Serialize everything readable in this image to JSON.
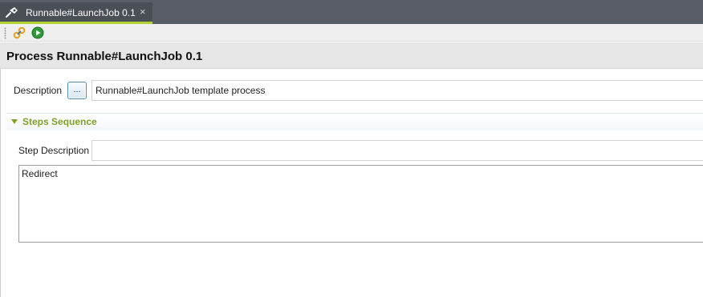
{
  "tab": {
    "title": "Runnable#LaunchJob 0.1",
    "close_glyph": "×"
  },
  "toolbar": {
    "buttons": [
      {
        "name": "refresh-links-icon",
        "color": "#e0a21a"
      },
      {
        "name": "run-icon",
        "color": "#2f9a3a"
      }
    ]
  },
  "header": {
    "title": "Process Runnable#LaunchJob 0.1"
  },
  "description": {
    "label": "Description",
    "button_label": "...",
    "value": "Runnable#LaunchJob template process"
  },
  "steps_section": {
    "title": "Steps Sequence",
    "step_description_label": "Step Description",
    "step_description_value": "",
    "steps_text": "Redirect"
  },
  "colors": {
    "tab_bar": "#595d65",
    "tab_active_underline": "#b3d134",
    "section_title": "#7fa12a"
  }
}
